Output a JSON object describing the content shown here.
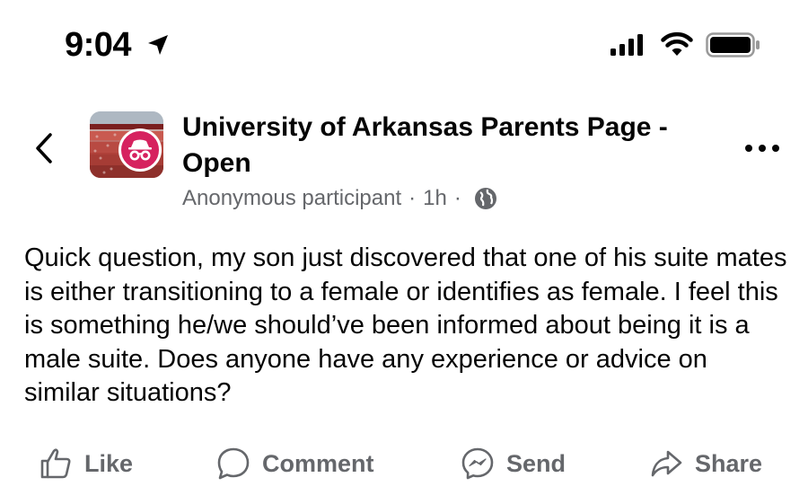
{
  "status_bar": {
    "time": "9:04",
    "icons": [
      "location-arrow-icon",
      "cellular-signal-icon",
      "wifi-icon",
      "battery-icon"
    ]
  },
  "header": {
    "back_icon": "chevron-left-icon",
    "group_name": "University of Arkansas Parents Page - Open",
    "author": "Anonymous participant",
    "separator": "·",
    "time_ago": "1h",
    "audience_icon": "globe-icon",
    "more_icon": "more-dots-icon",
    "avatar_badge_icon": "incognito-icon"
  },
  "post": {
    "text": "Quick question, my son just discovered that one of his suite mates is either transitioning to a female or identifies as female. I feel this is something he/we should’ve been informed about being it is a male suite. Does anyone have any experience or advice on similar situations?"
  },
  "actions": {
    "like": "Like",
    "comment": "Comment",
    "send": "Send",
    "share": "Share"
  },
  "colors": {
    "text_primary": "#050505",
    "text_secondary": "#65676b",
    "badge": "#d6225f"
  }
}
